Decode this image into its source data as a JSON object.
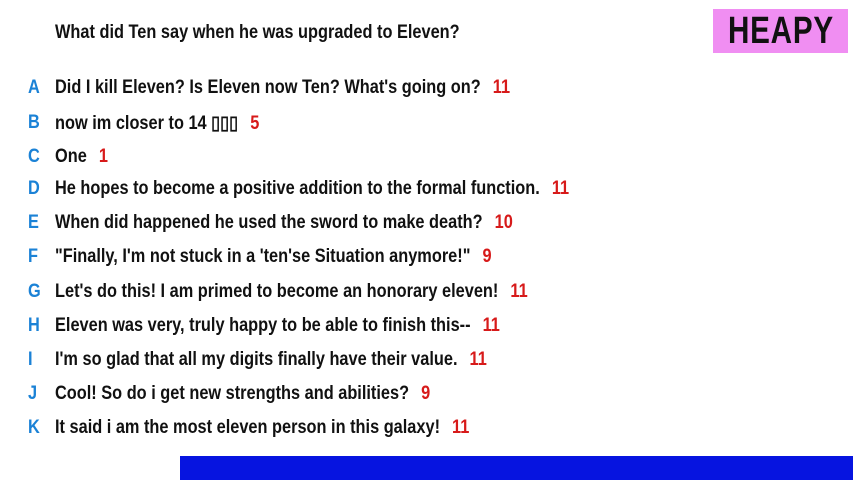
{
  "question": "What did Ten say when he was upgraded to Eleven?",
  "logo": "HEAPY",
  "answers": [
    {
      "letter": "A",
      "text": "Did I kill Eleven? Is Eleven now Ten? What's going on?",
      "score": "11"
    },
    {
      "letter": "B",
      "text": "now im closer to 14 ▯▯▯",
      "score": "5"
    },
    {
      "letter": "C",
      "text": "One",
      "score": "1"
    },
    {
      "letter": "D",
      "text": "He hopes to become a positive addition to the formal function.",
      "score": "11"
    },
    {
      "letter": "E",
      "text": "When did happened he used the sword to make death?",
      "score": "10"
    },
    {
      "letter": "F",
      "text": "\"Finally, I'm not stuck in a 'ten'se Situation anymore!\"",
      "score": "9"
    },
    {
      "letter": "G",
      "text": "Let's do this! I am primed to become an honorary eleven!",
      "score": "11"
    },
    {
      "letter": "H",
      "text": "Eleven was very, truly happy to be able to finish this--",
      "score": "11"
    },
    {
      "letter": "I",
      "text": "I'm so glad that all my digits finally have their value.",
      "score": "11"
    },
    {
      "letter": "J",
      "text": "Cool! So do i get new strengths and abilities?",
      "score": "9"
    },
    {
      "letter": "K",
      "text": "It said i am the most eleven person in this galaxy!",
      "score": "11"
    }
  ],
  "colors": {
    "letter": "#1b82d6",
    "score": "#d71a1a",
    "logo_bg": "#f08ef2",
    "bar": "#0614e0"
  }
}
